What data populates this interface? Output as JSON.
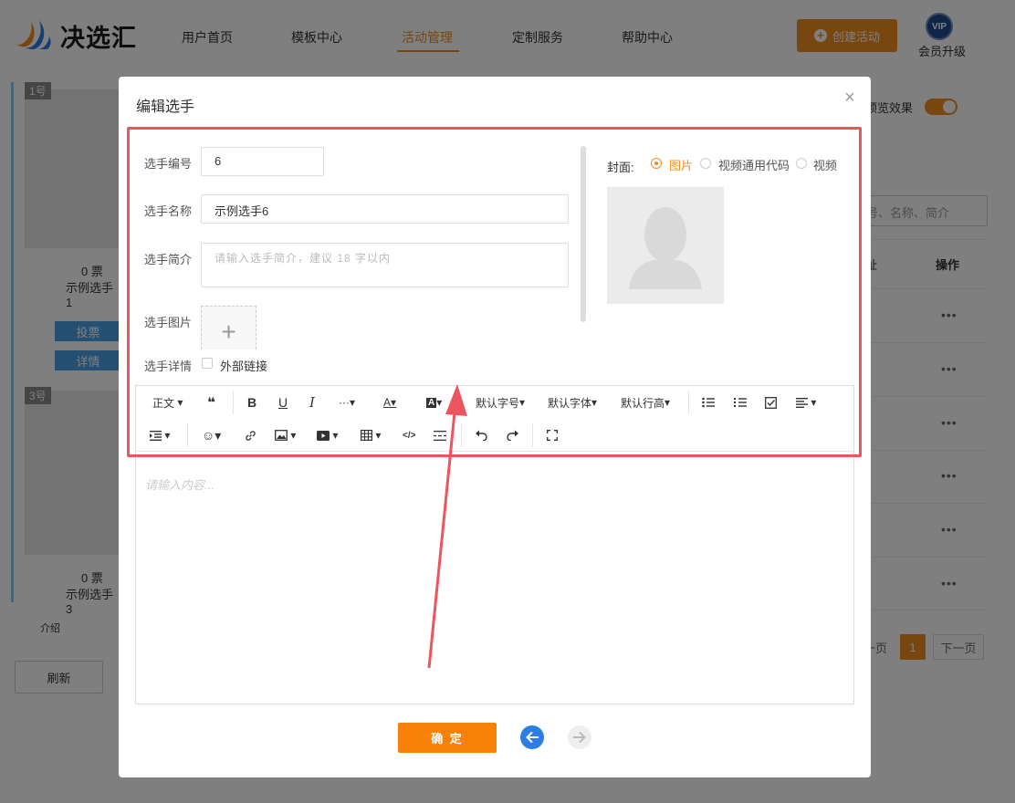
{
  "header": {
    "logo_text": "决选汇",
    "nav": [
      "用户首页",
      "模板中心",
      "活动管理",
      "定制服务",
      "帮助中心"
    ],
    "active_nav": "活动管理",
    "create_button": "创建活动",
    "vip_badge": "VIP",
    "vip_label": "会员升级"
  },
  "background": {
    "cards": [
      {
        "tag": "1号",
        "votes": "0 票",
        "name": "示例选手1",
        "vote_btn": "投票",
        "detail_btn": "详情"
      },
      {
        "tag": "3号",
        "votes": "0 票",
        "name": "示例选手3"
      }
    ],
    "intro_tab": "介绍",
    "refresh_button": "刷新",
    "preview_label": "预览效果",
    "search_placeholder": "号、名称、简介",
    "col_header": "操作",
    "col_header_left": "址",
    "row_action": "•••",
    "pagination": {
      "prev": "一页",
      "current": "1",
      "next": "下一页"
    }
  },
  "modal": {
    "title": "编辑选手",
    "close_icon": "×",
    "fields": {
      "number_label": "选手编号",
      "number_value": "6",
      "name_label": "选手名称",
      "name_value": "示例选手6",
      "intro_label": "选手简介",
      "intro_placeholder": "请输入选手简介，建议 18 字以内",
      "image_label": "选手图片",
      "detail_label": "选手详情",
      "external_link_label": "外部链接"
    },
    "cover": {
      "label": "封面:",
      "options": [
        "图片",
        "视频通用代码",
        "视频"
      ],
      "selected": "图片"
    },
    "toolbar": {
      "paragraph": "正文",
      "font_size": "默认字号",
      "font_family": "默认字体",
      "line_height": "默认行高"
    },
    "editor_placeholder": "请输入内容...",
    "confirm_button": "确 定"
  },
  "colors": {
    "brand_orange": "#f08d1e",
    "highlight_red": "#ec555d",
    "nav_blue": "#2b7ee6"
  }
}
